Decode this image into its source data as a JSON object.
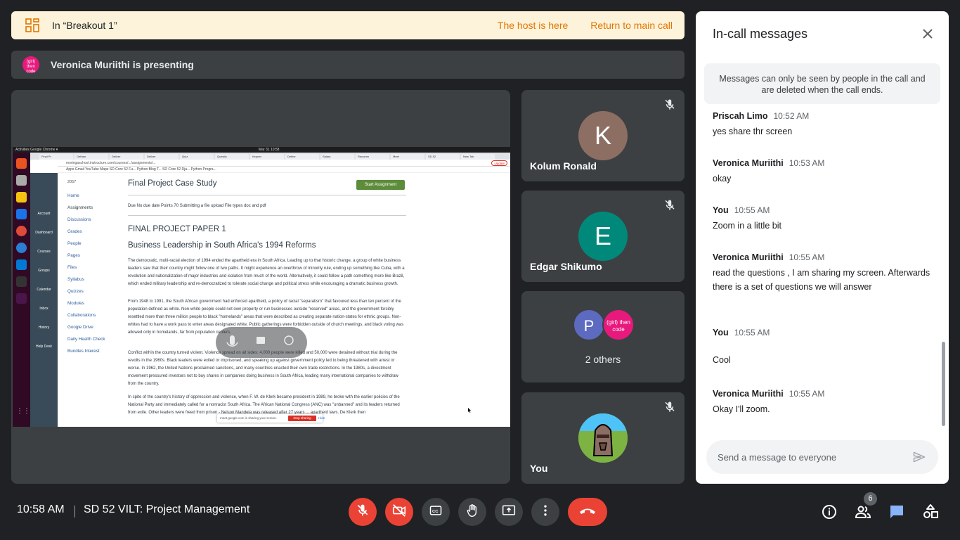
{
  "breakout": {
    "title": "In “Breakout 1”",
    "host_text": "The host is here",
    "return_label": "Return to main call",
    "accent": "#e37400"
  },
  "presenting": {
    "avatar_text": "(girl) then code",
    "text": "Veronica Muriithi is presenting"
  },
  "shared_screen": {
    "os_bar_left": "Activities   Google Chrome ▾",
    "os_bar_clock": "Mar 31  10:58",
    "tabs": [
      "Final Pr",
      "Gethan",
      "Deliver",
      "Deliver",
      "Quiz",
      "Questio",
      "Kepner",
      "Define",
      "Salary",
      "Recomm",
      "Meet",
      "SD 52",
      "New Tab"
    ],
    "url": "moringaschool.instructure.com/courses/.../assignments/...",
    "update_label": "Update",
    "bookmarks": "Apps   Gmail   YouTube   Maps   SD Core 52 Fu...   Python Blog T...   SD Core 52 Dja...   Python Progra...",
    "canvas_nav": [
      "Account",
      "Dashboard",
      "Courses",
      "Groups",
      "Calendar",
      "Inbox",
      "History",
      "Help Desk"
    ],
    "course_label": "2057",
    "course_nav": [
      "Home",
      "Assignments",
      "Discussions",
      "Grades",
      "People",
      "Pages",
      "Files",
      "Syllabus",
      "Quizzes",
      "Modules",
      "Collaborations",
      "Google Drive",
      "Daily Health Check",
      "Bundles Interest"
    ],
    "doc_title": "Final Project Case Study",
    "start_button": "Start Assignment",
    "meta": "Due   No due date      Points   70      Submitting   a file upload      File types   doc and pdf",
    "heading1": "FINAL PROJECT PAPER 1",
    "heading2": "Business Leadership in South Africa's 1994 Reforms",
    "paragraphs": [
      "The democratic, multi-racial election of 1994 ended the apartheid era in South Africa. Leading up to that historic change, a group of white business leaders saw that their country might follow one of two paths. It might experience an overthrow of minority rule, ending up something like Cuba, with a revolution and nationalization of major industries and isolation from much of the world. Alternatively, it could follow a path something more like Brazil, which ended military leadership and re-democratized to tolerate social change and political stress while encouraging a dramatic business growth.",
      "From 1948 to 1991, the South African government had enforced apartheid, a policy of racial \"separatism\" that favoured less than ten percent of the population defined as white. Non-white people could not own property or run businesses outside \"reserved\" areas, and the government forcibly resettled more than three million people to black \"homelands\" areas that were described as creating separate nation-states for ethnic groups. Non-whites had to have a work pass to enter areas designated white. Public gatherings were forbidden outside of church meetings, and black voting was allowed only in homelands, far from population centers.",
      "Conflict within the country turned violent. Violence spread on all sides: 4,000 people were killed and 50,000 were detained without trial during the revolts in the 1960s. Black leaders were exiled or imprisoned, and speaking up against government policy led to being threatened with arrest or worse. In 1962, the United Nations proclaimed sanctions, and many countries enacted their own trade restrictions. In the 1980s, a divestment movement pressured investors not to buy shares in companies doing business in South Africa, leading many international companies to withdraw from the country.",
      "In spite of the country's history of oppression and violence, when F. W. de Klerk became president in 1989, he broke with the earlier policies of the National Party and immediately called for a nonracist South Africa. The African National Congress (ANC) was \"unbanned\" and its leaders returned from exile. Other leaders were freed from prison - Nelson Mandela was released after 27 years ... apartheid laws. De Klerk then"
    ],
    "share_bar_text": "meet.google.com is sharing your screen.",
    "stop_sharing": "Stop sharing",
    "hide": "Hide"
  },
  "participants": [
    {
      "initial": "K",
      "name": "Kolum Ronald",
      "color": "#8d6e63",
      "muted": true
    },
    {
      "initial": "E",
      "name": "Edgar Shikumo",
      "color": "#00897b",
      "muted": true
    },
    {
      "others_label": "2 others",
      "av1": "P",
      "av1_color": "#5c6bc0",
      "av2": "(girl) then code",
      "av2_color": "#e8197d"
    },
    {
      "name": "You",
      "muted": true
    }
  ],
  "chat": {
    "title": "In-call messages",
    "notice": "Messages can only be seen by people in the call and are deleted when the call ends.",
    "messages": [
      {
        "sender": "Priscah Limo",
        "time": "10:52 AM",
        "text": "yes share thr screen"
      },
      {
        "sender": "Veronica Muriithi",
        "time": "10:53 AM",
        "text": "okay"
      },
      {
        "sender": "You",
        "time": "10:55 AM",
        "text": "Zoom in a little bit"
      },
      {
        "sender": "Veronica Muriithi",
        "time": "10:55 AM",
        "text": "read the questions , I am sharing my screen. Afterwards there is a set of questions we will answer"
      },
      {
        "sender": "You",
        "time": "10:55 AM",
        "text": "Cool"
      },
      {
        "sender": "Veronica Muriithi",
        "time": "10:55 AM",
        "text": "Okay I'll zoom."
      }
    ],
    "placeholder": "Send a message to everyone"
  },
  "bottom": {
    "time": "10:58 AM",
    "meeting_name": "SD 52 VILT: Project Management",
    "people_count": "6"
  },
  "colors": {
    "danger": "#ea4335",
    "chat_active": "#8ab4f8"
  }
}
